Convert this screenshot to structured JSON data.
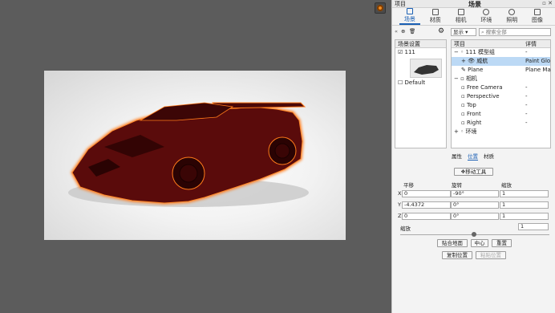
{
  "panel": {
    "left_title": "项目",
    "title": "场景"
  },
  "tabs": [
    {
      "label": "场景",
      "active": true
    },
    {
      "label": "材质"
    },
    {
      "label": "相机"
    },
    {
      "label": "环境"
    },
    {
      "label": "照明"
    },
    {
      "label": "图像"
    }
  ],
  "toolbar": {
    "show_label": "显示",
    "search_placeholder": "搜索全部"
  },
  "scene_sets": {
    "header": "场景设置",
    "items": [
      {
        "label": "111",
        "checked": true
      },
      {
        "label": "Default",
        "checked": false
      }
    ]
  },
  "tree": {
    "col1": "项目",
    "col2": "详情",
    "rows": [
      {
        "name": "111 模型组",
        "detail": "-",
        "level": 0
      },
      {
        "name": "威航",
        "detail": "Paint Glo",
        "level": 1,
        "selected": true
      },
      {
        "name": "Plane",
        "detail": "Plane Ma",
        "level": 1
      },
      {
        "name": "相机",
        "detail": "",
        "level": 0
      },
      {
        "name": "Free Camera",
        "detail": "-",
        "level": 1
      },
      {
        "name": "Perspective",
        "detail": "-",
        "level": 1
      },
      {
        "name": "Top",
        "detail": "-",
        "level": 1
      },
      {
        "name": "Front",
        "detail": "-",
        "level": 1
      },
      {
        "name": "Right",
        "detail": "-",
        "level": 1
      },
      {
        "name": "环境",
        "detail": "",
        "level": 0
      }
    ]
  },
  "sub_tabs": {
    "props": "属性",
    "position": "位置",
    "material": "材质"
  },
  "move_tool": "移动工具",
  "transform": {
    "translate": "平移",
    "rotate": "旋转",
    "scale": "缩放",
    "x": {
      "t": "0",
      "r": "-90°",
      "s": "1"
    },
    "y": {
      "t": "-4.4372",
      "r": "0°",
      "s": "1"
    },
    "z": {
      "t": "0",
      "r": "0°",
      "s": "1"
    }
  },
  "uniform_scale": {
    "label": "缩放",
    "value": "1"
  },
  "buttons": {
    "snap_ground": "贴合地面",
    "center": "中心",
    "reset": "重置",
    "copy_pos": "复制位置",
    "paste_pos": "粘贴位置"
  },
  "colors": {
    "car": "#5a0b0b",
    "outline": "#ff7a1a"
  }
}
